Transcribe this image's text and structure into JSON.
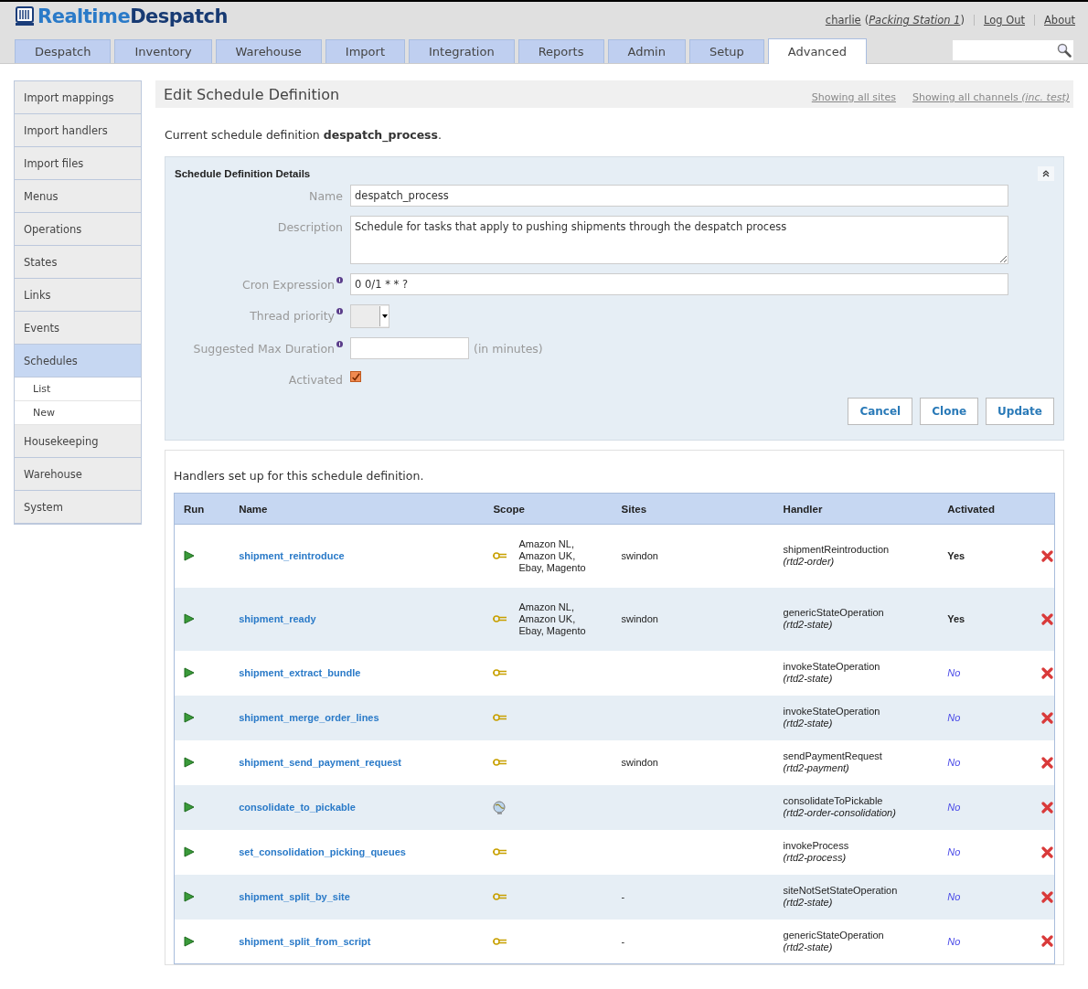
{
  "header": {
    "logo_light": "Realtime",
    "logo_dark": "Despatch",
    "user": "charlie",
    "paren_open": "(",
    "station": "Packing Station 1",
    "paren_close": ")",
    "links": [
      "Log Out",
      "About"
    ]
  },
  "tabs": [
    {
      "label": "Despatch",
      "selected": false
    },
    {
      "label": "Inventory",
      "selected": false
    },
    {
      "label": "Warehouse",
      "selected": false
    },
    {
      "label": "Import",
      "selected": false
    },
    {
      "label": "Integration",
      "selected": false
    },
    {
      "label": "Reports",
      "selected": false
    },
    {
      "label": "Admin",
      "selected": false
    },
    {
      "label": "Setup",
      "selected": false
    },
    {
      "label": "Advanced",
      "selected": true
    }
  ],
  "sidebar": {
    "items": [
      {
        "label": "Import mappings",
        "selected": false
      },
      {
        "label": "Import handlers",
        "selected": false
      },
      {
        "label": "Import files",
        "selected": false
      },
      {
        "label": "Menus",
        "selected": false
      },
      {
        "label": "Operations",
        "selected": false
      },
      {
        "label": "States",
        "selected": false
      },
      {
        "label": "Links",
        "selected": false
      },
      {
        "label": "Events",
        "selected": false
      },
      {
        "label": "Schedules",
        "selected": true,
        "children": [
          {
            "label": "List"
          },
          {
            "label": "New"
          }
        ]
      },
      {
        "label": "Housekeeping",
        "selected": false
      },
      {
        "label": "Warehouse",
        "selected": false
      },
      {
        "label": "System",
        "selected": false
      }
    ]
  },
  "page": {
    "title": "Edit Schedule Definition",
    "filters": [
      "Showing all sites",
      "Showing all channels *(inc. test)*"
    ],
    "intro": "Current schedule definition **despatch_process**."
  },
  "details": {
    "title": "Schedule Definition Details",
    "fields": [
      {
        "kind": "text",
        "label": "Name",
        "info": false,
        "value": "despatch_process"
      },
      {
        "kind": "textarea",
        "label": "Description",
        "info": false,
        "value": "Schedule for tasks that apply to pushing shipments through the despatch process"
      },
      {
        "kind": "text",
        "label": "Cron Expression",
        "info": true,
        "value": "0 0/1 * * ?"
      },
      {
        "kind": "select",
        "label": "Thread priority",
        "info": true
      },
      {
        "kind": "short",
        "label": "Suggested Max Duration",
        "info": true,
        "suffix": "(in minutes)"
      },
      {
        "kind": "checkbox",
        "label": "Activated",
        "info": false,
        "checked": true
      }
    ],
    "buttons": [
      "Cancel",
      "Clone",
      "Update"
    ]
  },
  "handlers": {
    "caption": "Handlers set up for this schedule definition.",
    "columns": [
      "Run",
      "Name",
      "Scope",
      "Sites",
      "Handler",
      "Activated"
    ],
    "rows": [
      {
        "name": "shipment_reintroduce",
        "scope": {
          "kind": "plug",
          "text": "Amazon NL,\nAmazon UK,\nEbay, Magento"
        },
        "sites": "swindon",
        "handler": "shipmentReintroduction",
        "module": "(rtd2-order)",
        "activated": true,
        "activated_text": "Yes"
      },
      {
        "name": "shipment_ready",
        "scope": {
          "kind": "plug",
          "text": "Amazon NL,\nAmazon UK,\nEbay, Magento"
        },
        "sites": "swindon",
        "handler": "genericStateOperation",
        "module": "(rtd2-state)",
        "activated": true,
        "activated_text": "Yes"
      },
      {
        "name": "shipment_extract_bundle",
        "scope": {
          "kind": "plug"
        },
        "handler": "invokeStateOperation",
        "module": "(rtd2-state)",
        "activated": false,
        "activated_text": "No"
      },
      {
        "name": "shipment_merge_order_lines",
        "scope": {
          "kind": "plug"
        },
        "handler": "invokeStateOperation",
        "module": "(rtd2-state)",
        "activated": false,
        "activated_text": "No"
      },
      {
        "name": "shipment_send_payment_request",
        "scope": {
          "kind": "plug"
        },
        "sites": "swindon",
        "handler": "sendPaymentRequest",
        "module": "(rtd2-payment)",
        "activated": false,
        "activated_text": "No"
      },
      {
        "name": "consolidate_to_pickable",
        "scope": {
          "kind": "globe"
        },
        "handler": "consolidateToPickable",
        "module": "(rtd2-order-consolidation)",
        "activated": false,
        "activated_text": "No"
      },
      {
        "name": "set_consolidation_picking_queues",
        "scope": {
          "kind": "plug"
        },
        "handler": "invokeProcess",
        "module": "(rtd2-process)",
        "activated": false,
        "activated_text": "No"
      },
      {
        "name": "shipment_split_by_site",
        "scope": {
          "kind": "plug"
        },
        "sites": "-",
        "handler": "siteNotSetStateOperation",
        "module": "(rtd2-state)",
        "activated": false,
        "activated_text": "No"
      },
      {
        "name": "shipment_split_from_script",
        "scope": {
          "kind": "plug"
        },
        "sites": "-",
        "handler": "genericStateOperation",
        "module": "(rtd2-state)",
        "activated": false,
        "activated_text": "No"
      }
    ]
  }
}
